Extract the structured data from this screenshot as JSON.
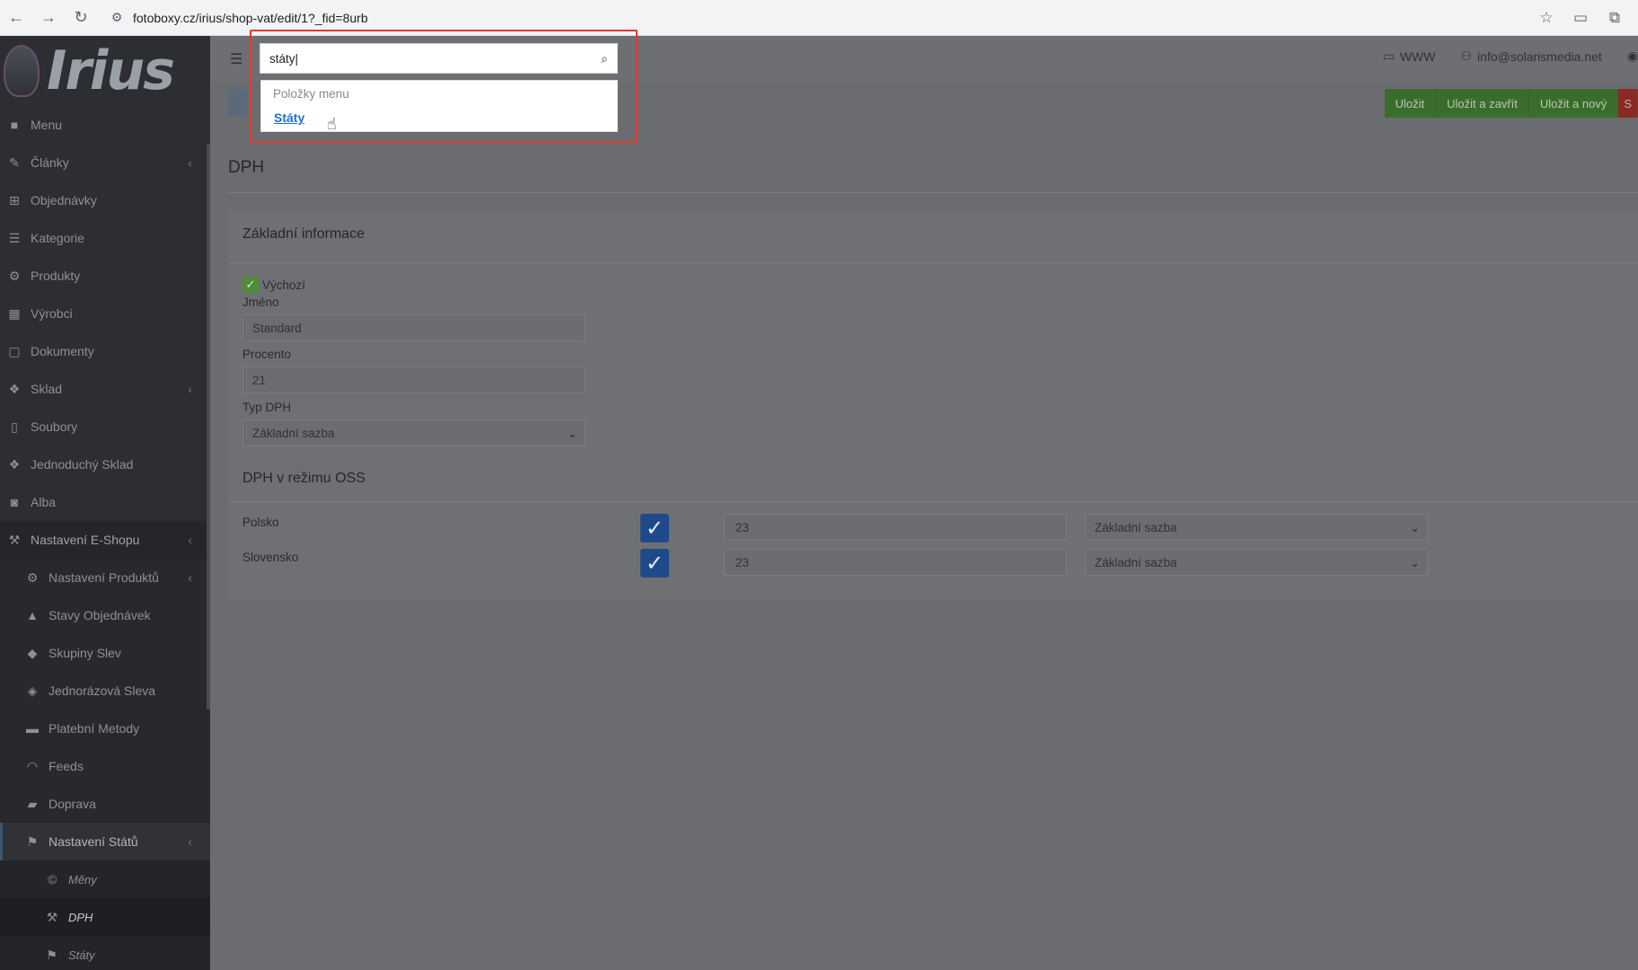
{
  "browser": {
    "url": "fotoboxy.cz/irius/shop-vat/edit/1?_fid=8urb"
  },
  "brand": {
    "logo_text": "Irius"
  },
  "sidebar": {
    "items": [
      {
        "label": "Menu",
        "icon": "folder-icon",
        "chev": ""
      },
      {
        "label": "Články",
        "icon": "pencil-icon",
        "chev": "‹"
      },
      {
        "label": "Objednávky",
        "icon": "cart-icon",
        "chev": ""
      },
      {
        "label": "Kategorie",
        "icon": "list-icon",
        "chev": ""
      },
      {
        "label": "Produkty",
        "icon": "gear-icon",
        "chev": ""
      },
      {
        "label": "Výrobci",
        "icon": "building-icon",
        "chev": ""
      },
      {
        "label": "Dokumenty",
        "icon": "document-icon",
        "chev": ""
      },
      {
        "label": "Sklad",
        "icon": "boxes-icon",
        "chev": "‹"
      },
      {
        "label": "Soubory",
        "icon": "file-icon",
        "chev": ""
      },
      {
        "label": "Jednoduchý Sklad",
        "icon": "boxes-icon",
        "chev": ""
      },
      {
        "label": "Alba",
        "icon": "camera-icon",
        "chev": ""
      },
      {
        "label": "Nastavení E-Shopu",
        "icon": "settings-icon",
        "chev": "‹"
      },
      {
        "label": "Nastavení Produktů",
        "icon": "gear-icon",
        "chev": "‹"
      },
      {
        "label": "Stavy Objednávek",
        "icon": "bell-icon",
        "chev": ""
      },
      {
        "label": "Skupiny Slev",
        "icon": "tag-icon",
        "chev": ""
      },
      {
        "label": "Jednorázová Sleva",
        "icon": "tags-icon",
        "chev": ""
      },
      {
        "label": "Platební Metody",
        "icon": "card-icon",
        "chev": ""
      },
      {
        "label": "Feeds",
        "icon": "rss-icon",
        "chev": ""
      },
      {
        "label": "Doprava",
        "icon": "truck-icon",
        "chev": ""
      },
      {
        "label": "Nastavení Států",
        "icon": "flag-icon",
        "chev": "‹"
      },
      {
        "label": "Měny",
        "icon": "copyright-icon",
        "chev": ""
      },
      {
        "label": "DPH",
        "icon": "gavel-icon",
        "chev": ""
      },
      {
        "label": "Státy",
        "icon": "flag-icon",
        "chev": ""
      }
    ]
  },
  "topbar": {
    "www_label": "WWW",
    "user_email": "info@solarismedia.net"
  },
  "actions": {
    "save": "Uložit",
    "save_close": "Uložit a zavřít",
    "save_new": "Uložit a nový",
    "extra": "S"
  },
  "page": {
    "title": "DPH"
  },
  "form": {
    "section_basic": "Základní informace",
    "default_label": "Výchozí",
    "name_label": "Jméno",
    "name_value": "Standard",
    "percent_label": "Procento",
    "percent_value": "21",
    "type_label": "Typ DPH",
    "type_value": "Základní sazba",
    "section_oss": "DPH v režimu OSS",
    "oss": [
      {
        "country": "Polsko",
        "rate": "23",
        "type": "Základní sazba"
      },
      {
        "country": "Slovensko",
        "rate": "23",
        "type": "Základní sazba"
      }
    ]
  },
  "search": {
    "query": "státy",
    "group_header": "Položky menu",
    "result": "Státy"
  },
  "colors": {
    "highlight": "#e03b2f",
    "action_green": "#3a6d2c",
    "checkbox_blue": "#1f4a8a",
    "link_blue": "#1f6fd0"
  }
}
